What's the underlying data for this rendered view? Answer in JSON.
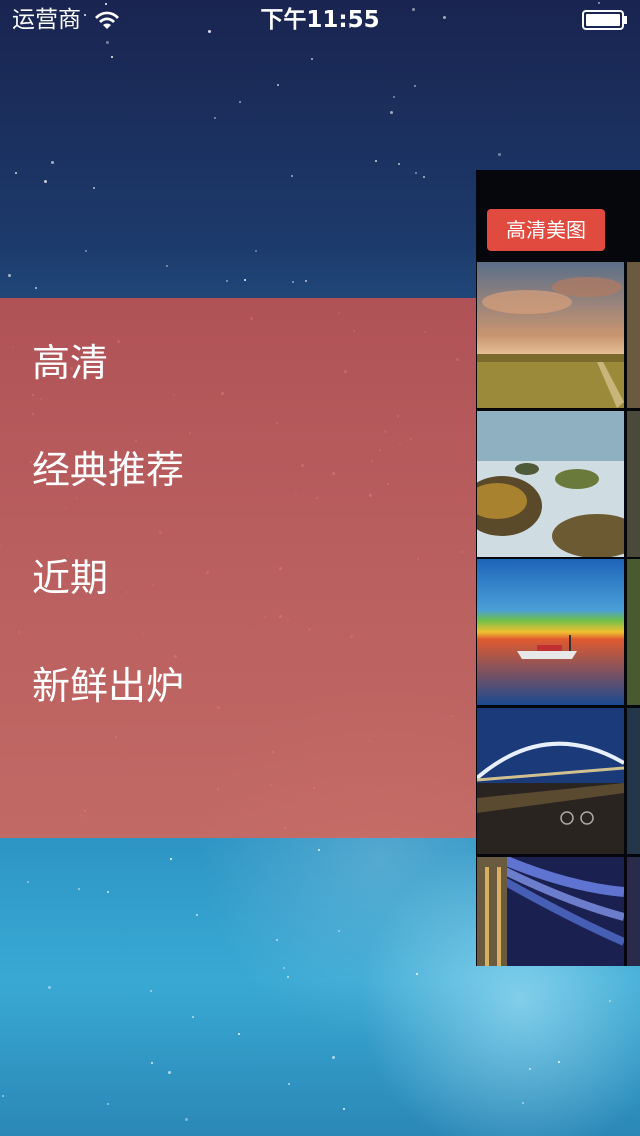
{
  "status_bar": {
    "carrier": "运营商",
    "time": "下午11:55"
  },
  "menu": {
    "items": [
      "高清",
      "经典推荐",
      "近期",
      "新鲜出炉"
    ]
  },
  "content": {
    "hd_button_label": "高清美图"
  },
  "colors": {
    "menu_bg": "#c4544f",
    "button_red": "#e04a3f"
  }
}
